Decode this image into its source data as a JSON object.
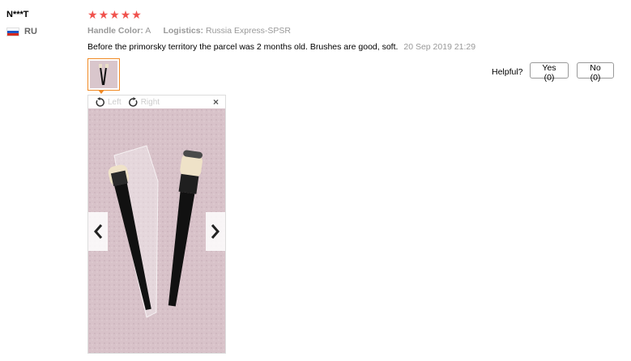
{
  "reviewer": {
    "name": "N***T",
    "country_code": "RU",
    "flag_colors": [
      "#ffffff",
      "#1c57c7",
      "#d52b1e"
    ]
  },
  "rating": {
    "stars": 5,
    "color": "#f0524d"
  },
  "attributes": {
    "handle_color_label": "Handle Color:",
    "handle_color_value": "A",
    "logistics_label": "Logistics:",
    "logistics_value": "Russia Express-SPSR"
  },
  "review": {
    "text": "Before the primorsky territory the parcel was 2 months old. Brushes are good, soft.",
    "date": "20 Sep 2019 21:29"
  },
  "helpful": {
    "label": "Helpful?",
    "yes_label": "Yes (0)",
    "no_label": "No (0)"
  },
  "viewer": {
    "rotate_left_label": "Left",
    "rotate_right_label": "Right",
    "close_glyph": "×",
    "icons": [
      "rotate-left-icon",
      "rotate-right-icon",
      "close-icon",
      "chevron-left-icon",
      "chevron-right-icon"
    ]
  },
  "colors": {
    "accent": "#f08a24",
    "star": "#f0524d",
    "muted": "#999999"
  }
}
